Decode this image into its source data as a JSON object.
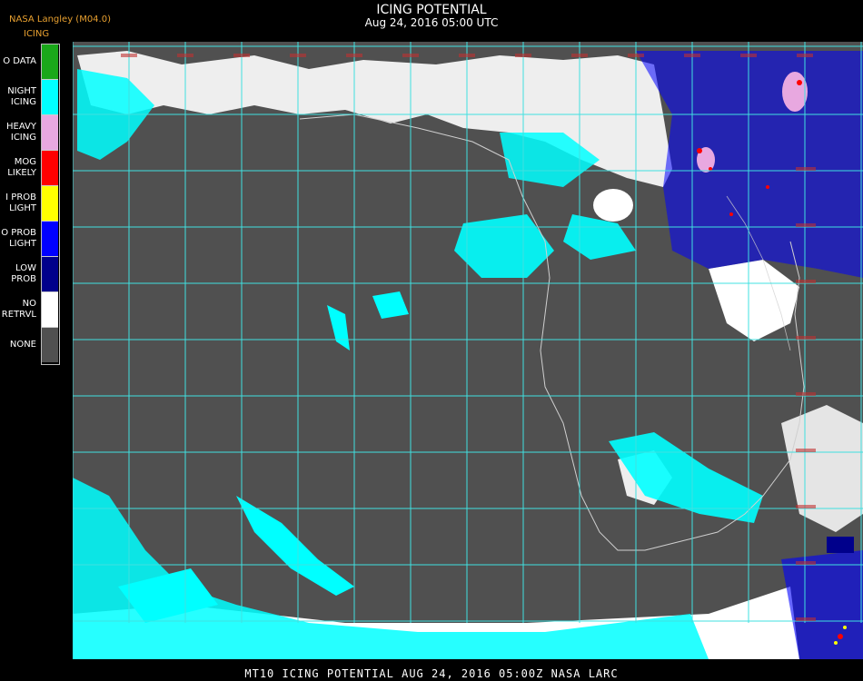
{
  "header": {
    "source": "NASA Langley (M04.0)",
    "legend_heading": "ICING",
    "title": "ICING POTENTIAL",
    "timestamp": "Aug 24, 2016 05:00 UTC"
  },
  "legend": [
    {
      "label": "O DATA",
      "color": "#1aa81a"
    },
    {
      "label": "NIGHT\nICING",
      "color": "#00ffff"
    },
    {
      "label": "HEAVY\nICING",
      "color": "#e8a8e0"
    },
    {
      "label": "MOG\nLIKELY",
      "color": "#ff0000"
    },
    {
      "label": "I PROB\nLIGHT",
      "color": "#ffff00"
    },
    {
      "label": "O PROB\nLIGHT",
      "color": "#0000ff"
    },
    {
      "label": "LOW\nPROB",
      "color": "#00008b"
    },
    {
      "label": "NO\nRETRVL",
      "color": "#ffffff"
    },
    {
      "label": "NONE",
      "color": "#505050"
    }
  ],
  "map": {
    "background_color": "#505050",
    "grid_color": "#40e0e0",
    "coastline_color": "#d0d0d0"
  },
  "footer": {
    "text": "MT10  ICING POTENTIAL   AUG 24, 2016 05:00Z   NASA LARC"
  }
}
